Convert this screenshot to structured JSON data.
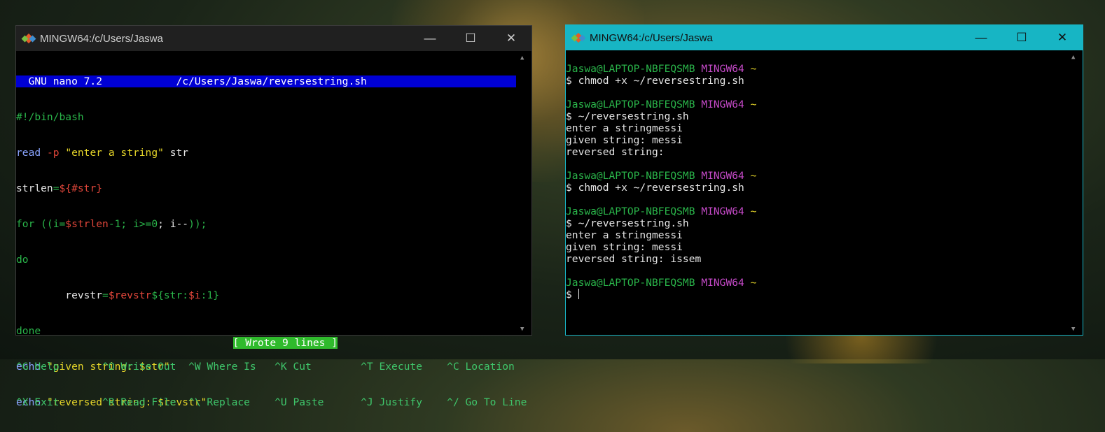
{
  "left_window": {
    "title": "MINGW64:/c/Users/Jaswa",
    "controls": {
      "minimize": "—",
      "maximize": "☐",
      "close": "✕"
    },
    "nano_header": "  GNU nano 7.2            /c/Users/Jaswa/reversestring.sh",
    "code": {
      "l1": "#!/bin/bash",
      "l2_read": "read",
      "l2_flag": "-p",
      "l2_str": "\"enter a string\"",
      "l2_var": " str",
      "l3_name": "strlen",
      "l3_eq": "=",
      "l3_val": "${#str}",
      "l4_for": "for",
      "l4_open": " ((i=",
      "l4_var": "$strlen",
      "l4_rest1": "-1; i",
      "l4_op": ">=",
      "l4_zero": "0",
      "l4_rest2": "; i",
      "l4_dec": "--",
      "l4_close": "));",
      "l5": "do",
      "l6_indent": "        revstr",
      "l6_eq": "=",
      "l6_var": "$revstr",
      "l6_sub1": "${str:",
      "l6_i": "$i",
      "l6_sub2": ":1}",
      "l7": "done",
      "l8_echo": "echo",
      "l8_str": " \"given string: $str\"",
      "l9_echo": "echo",
      "l9_str": " \"reversed string: $revstr\""
    },
    "status": "[ Wrote 9 lines ]",
    "shortcuts_row1": [
      {
        "key": "^G",
        "label": " Help      "
      },
      {
        "key": "^O",
        "label": " Write Out "
      },
      {
        "key": "^W",
        "label": " Where Is  "
      },
      {
        "key": "^K",
        "label": " Cut       "
      },
      {
        "key": "^T",
        "label": " Execute   "
      },
      {
        "key": "^C",
        "label": " Location"
      }
    ],
    "shortcuts_row2": [
      {
        "key": "^X",
        "label": " Exit      "
      },
      {
        "key": "^R",
        "label": " Read File "
      },
      {
        "key": "^\\",
        "label": " Replace   "
      },
      {
        "key": "^U",
        "label": " Paste     "
      },
      {
        "key": "^J",
        "label": " Justify   "
      },
      {
        "key": "^/",
        "label": " Go To Line"
      }
    ]
  },
  "right_window": {
    "title": "MINGW64:/c/Users/Jaswa",
    "controls": {
      "minimize": "—",
      "maximize": "☐",
      "close": "✕"
    },
    "prompt_user": "Jaswa@LAPTOP-NBFEQSMB",
    "prompt_env": "MINGW64",
    "prompt_dir": "~",
    "sessions": [
      {
        "cmd": "$ chmod +x ~/reversestring.sh",
        "output": []
      },
      {
        "cmd": "$ ~/reversestring.sh",
        "output": [
          "enter a stringmessi",
          "given string: messi",
          "reversed string:"
        ]
      },
      {
        "cmd": "$ chmod +x ~/reversestring.sh",
        "output": []
      },
      {
        "cmd": "$ ~/reversestring.sh",
        "output": [
          "enter a stringmessi",
          "given string: messi",
          "reversed string: issem"
        ]
      }
    ],
    "final_prompt": "$ "
  },
  "colors": {
    "right_titlebar": "#17b5c4",
    "nano_header_bg": "#0000d4",
    "status_bg": "#2fba2c",
    "prompt_green": "#2ab54a",
    "prompt_magenta": "#c64ac9",
    "prompt_yellow": "#e6d629"
  },
  "icons": {
    "app": "git-bash-diamond-icon",
    "scroll_up": "▲",
    "scroll_down": "▼"
  }
}
